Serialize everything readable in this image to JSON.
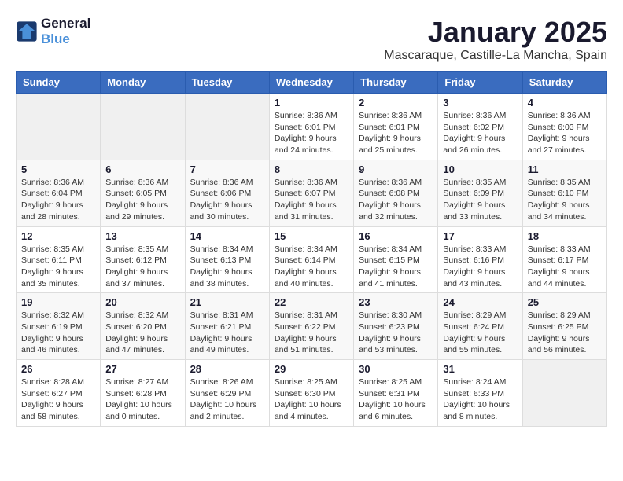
{
  "logo": {
    "line1": "General",
    "line2": "Blue"
  },
  "title": "January 2025",
  "location": "Mascaraque, Castille-La Mancha, Spain",
  "weekdays": [
    "Sunday",
    "Monday",
    "Tuesday",
    "Wednesday",
    "Thursday",
    "Friday",
    "Saturday"
  ],
  "weeks": [
    [
      {
        "day": "",
        "info": ""
      },
      {
        "day": "",
        "info": ""
      },
      {
        "day": "",
        "info": ""
      },
      {
        "day": "1",
        "info": "Sunrise: 8:36 AM\nSunset: 6:01 PM\nDaylight: 9 hours\nand 24 minutes."
      },
      {
        "day": "2",
        "info": "Sunrise: 8:36 AM\nSunset: 6:01 PM\nDaylight: 9 hours\nand 25 minutes."
      },
      {
        "day": "3",
        "info": "Sunrise: 8:36 AM\nSunset: 6:02 PM\nDaylight: 9 hours\nand 26 minutes."
      },
      {
        "day": "4",
        "info": "Sunrise: 8:36 AM\nSunset: 6:03 PM\nDaylight: 9 hours\nand 27 minutes."
      }
    ],
    [
      {
        "day": "5",
        "info": "Sunrise: 8:36 AM\nSunset: 6:04 PM\nDaylight: 9 hours\nand 28 minutes."
      },
      {
        "day": "6",
        "info": "Sunrise: 8:36 AM\nSunset: 6:05 PM\nDaylight: 9 hours\nand 29 minutes."
      },
      {
        "day": "7",
        "info": "Sunrise: 8:36 AM\nSunset: 6:06 PM\nDaylight: 9 hours\nand 30 minutes."
      },
      {
        "day": "8",
        "info": "Sunrise: 8:36 AM\nSunset: 6:07 PM\nDaylight: 9 hours\nand 31 minutes."
      },
      {
        "day": "9",
        "info": "Sunrise: 8:36 AM\nSunset: 6:08 PM\nDaylight: 9 hours\nand 32 minutes."
      },
      {
        "day": "10",
        "info": "Sunrise: 8:35 AM\nSunset: 6:09 PM\nDaylight: 9 hours\nand 33 minutes."
      },
      {
        "day": "11",
        "info": "Sunrise: 8:35 AM\nSunset: 6:10 PM\nDaylight: 9 hours\nand 34 minutes."
      }
    ],
    [
      {
        "day": "12",
        "info": "Sunrise: 8:35 AM\nSunset: 6:11 PM\nDaylight: 9 hours\nand 35 minutes."
      },
      {
        "day": "13",
        "info": "Sunrise: 8:35 AM\nSunset: 6:12 PM\nDaylight: 9 hours\nand 37 minutes."
      },
      {
        "day": "14",
        "info": "Sunrise: 8:34 AM\nSunset: 6:13 PM\nDaylight: 9 hours\nand 38 minutes."
      },
      {
        "day": "15",
        "info": "Sunrise: 8:34 AM\nSunset: 6:14 PM\nDaylight: 9 hours\nand 40 minutes."
      },
      {
        "day": "16",
        "info": "Sunrise: 8:34 AM\nSunset: 6:15 PM\nDaylight: 9 hours\nand 41 minutes."
      },
      {
        "day": "17",
        "info": "Sunrise: 8:33 AM\nSunset: 6:16 PM\nDaylight: 9 hours\nand 43 minutes."
      },
      {
        "day": "18",
        "info": "Sunrise: 8:33 AM\nSunset: 6:17 PM\nDaylight: 9 hours\nand 44 minutes."
      }
    ],
    [
      {
        "day": "19",
        "info": "Sunrise: 8:32 AM\nSunset: 6:19 PM\nDaylight: 9 hours\nand 46 minutes."
      },
      {
        "day": "20",
        "info": "Sunrise: 8:32 AM\nSunset: 6:20 PM\nDaylight: 9 hours\nand 47 minutes."
      },
      {
        "day": "21",
        "info": "Sunrise: 8:31 AM\nSunset: 6:21 PM\nDaylight: 9 hours\nand 49 minutes."
      },
      {
        "day": "22",
        "info": "Sunrise: 8:31 AM\nSunset: 6:22 PM\nDaylight: 9 hours\nand 51 minutes."
      },
      {
        "day": "23",
        "info": "Sunrise: 8:30 AM\nSunset: 6:23 PM\nDaylight: 9 hours\nand 53 minutes."
      },
      {
        "day": "24",
        "info": "Sunrise: 8:29 AM\nSunset: 6:24 PM\nDaylight: 9 hours\nand 55 minutes."
      },
      {
        "day": "25",
        "info": "Sunrise: 8:29 AM\nSunset: 6:25 PM\nDaylight: 9 hours\nand 56 minutes."
      }
    ],
    [
      {
        "day": "26",
        "info": "Sunrise: 8:28 AM\nSunset: 6:27 PM\nDaylight: 9 hours\nand 58 minutes."
      },
      {
        "day": "27",
        "info": "Sunrise: 8:27 AM\nSunset: 6:28 PM\nDaylight: 10 hours\nand 0 minutes."
      },
      {
        "day": "28",
        "info": "Sunrise: 8:26 AM\nSunset: 6:29 PM\nDaylight: 10 hours\nand 2 minutes."
      },
      {
        "day": "29",
        "info": "Sunrise: 8:25 AM\nSunset: 6:30 PM\nDaylight: 10 hours\nand 4 minutes."
      },
      {
        "day": "30",
        "info": "Sunrise: 8:25 AM\nSunset: 6:31 PM\nDaylight: 10 hours\nand 6 minutes."
      },
      {
        "day": "31",
        "info": "Sunrise: 8:24 AM\nSunset: 6:33 PM\nDaylight: 10 hours\nand 8 minutes."
      },
      {
        "day": "",
        "info": ""
      }
    ]
  ]
}
